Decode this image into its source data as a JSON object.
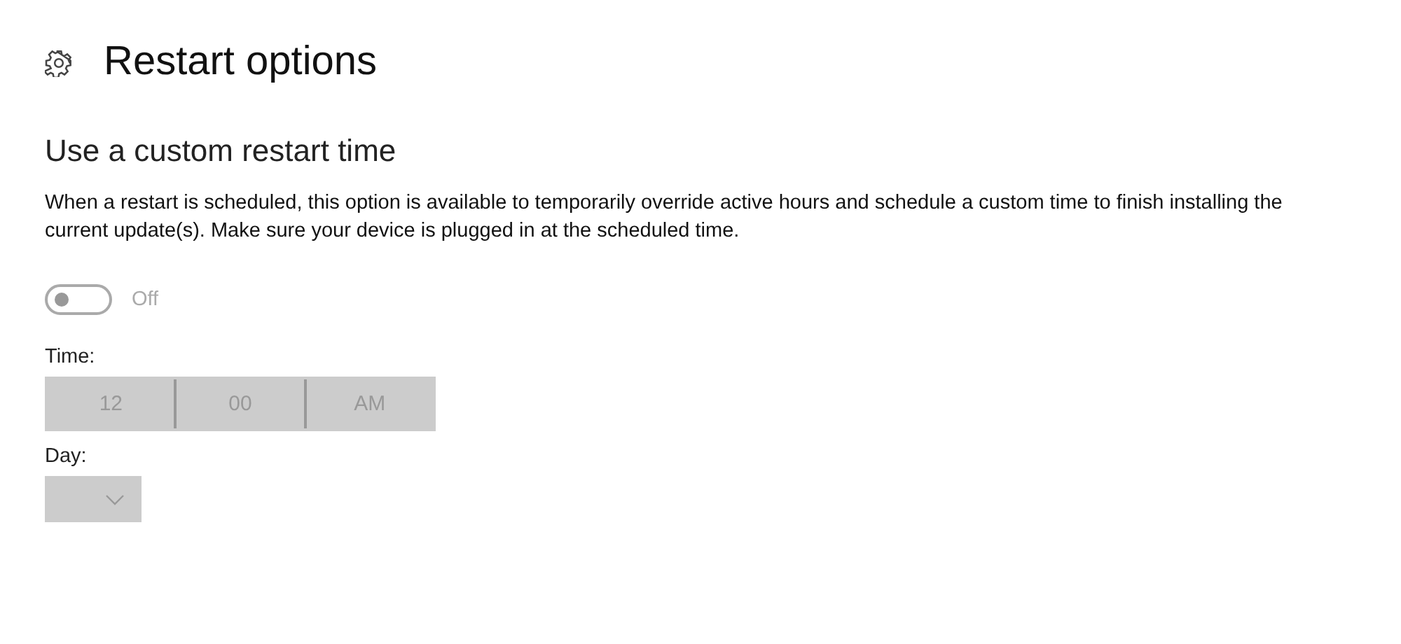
{
  "page": {
    "title": "Restart options"
  },
  "section": {
    "heading": "Use a custom restart time",
    "description": "When a restart is scheduled, this option is available to temporarily override active hours and schedule a custom time to finish installing the current update(s). Make sure your device is plugged in at the scheduled time."
  },
  "toggle": {
    "on": false,
    "disabled": true,
    "label": "Off"
  },
  "time_picker": {
    "label": "Time:",
    "disabled": true,
    "segments": [
      "12",
      "00",
      "AM"
    ]
  },
  "day_dropdown": {
    "label": "Day:",
    "disabled": true
  }
}
